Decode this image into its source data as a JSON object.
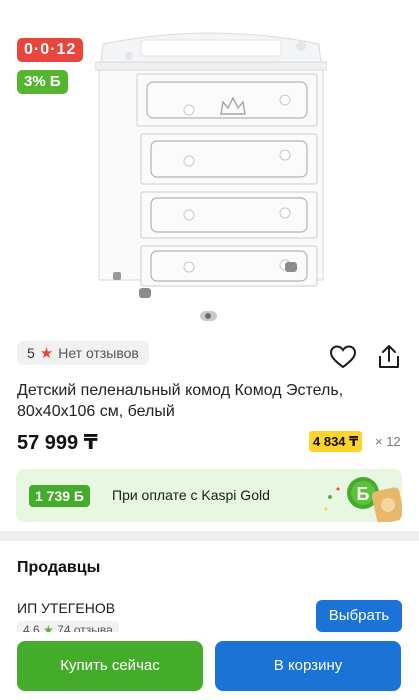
{
  "product": {
    "badges": {
      "installment": "0·0·12",
      "bonus": "3% Б"
    },
    "rating": {
      "score": "5",
      "reviews_text": "Нет отзывов"
    },
    "title": "Детский пеленальный комод Комод Эстель, 80x40x106 см, белый",
    "price": "57 999 ₸",
    "installment": {
      "monthly": "4 834 ₸",
      "multiplier": "× 12"
    }
  },
  "gold_banner": {
    "bonus": "1 739 Б",
    "text": "При оплате с Kaspi Gold"
  },
  "sellers": {
    "title": "Продавцы",
    "seller": {
      "name": "ИП УТЕГЕНОВ",
      "rating": "4.6",
      "reviews": "74 отзыва"
    },
    "choose_label": "Выбрать"
  },
  "actions": {
    "buy_label": "Купить сейчас",
    "cart_label": "В корзину"
  },
  "icons": [
    "heart-icon",
    "share-icon",
    "star-icon",
    "kaspi-bonus-icon",
    "pagination-dot-icon"
  ],
  "colors": {
    "kaspi_red": "#e8453c",
    "bonus_green": "#56b530",
    "action_blue": "#1a73d5",
    "installment_yellow": "#ffd22e"
  }
}
